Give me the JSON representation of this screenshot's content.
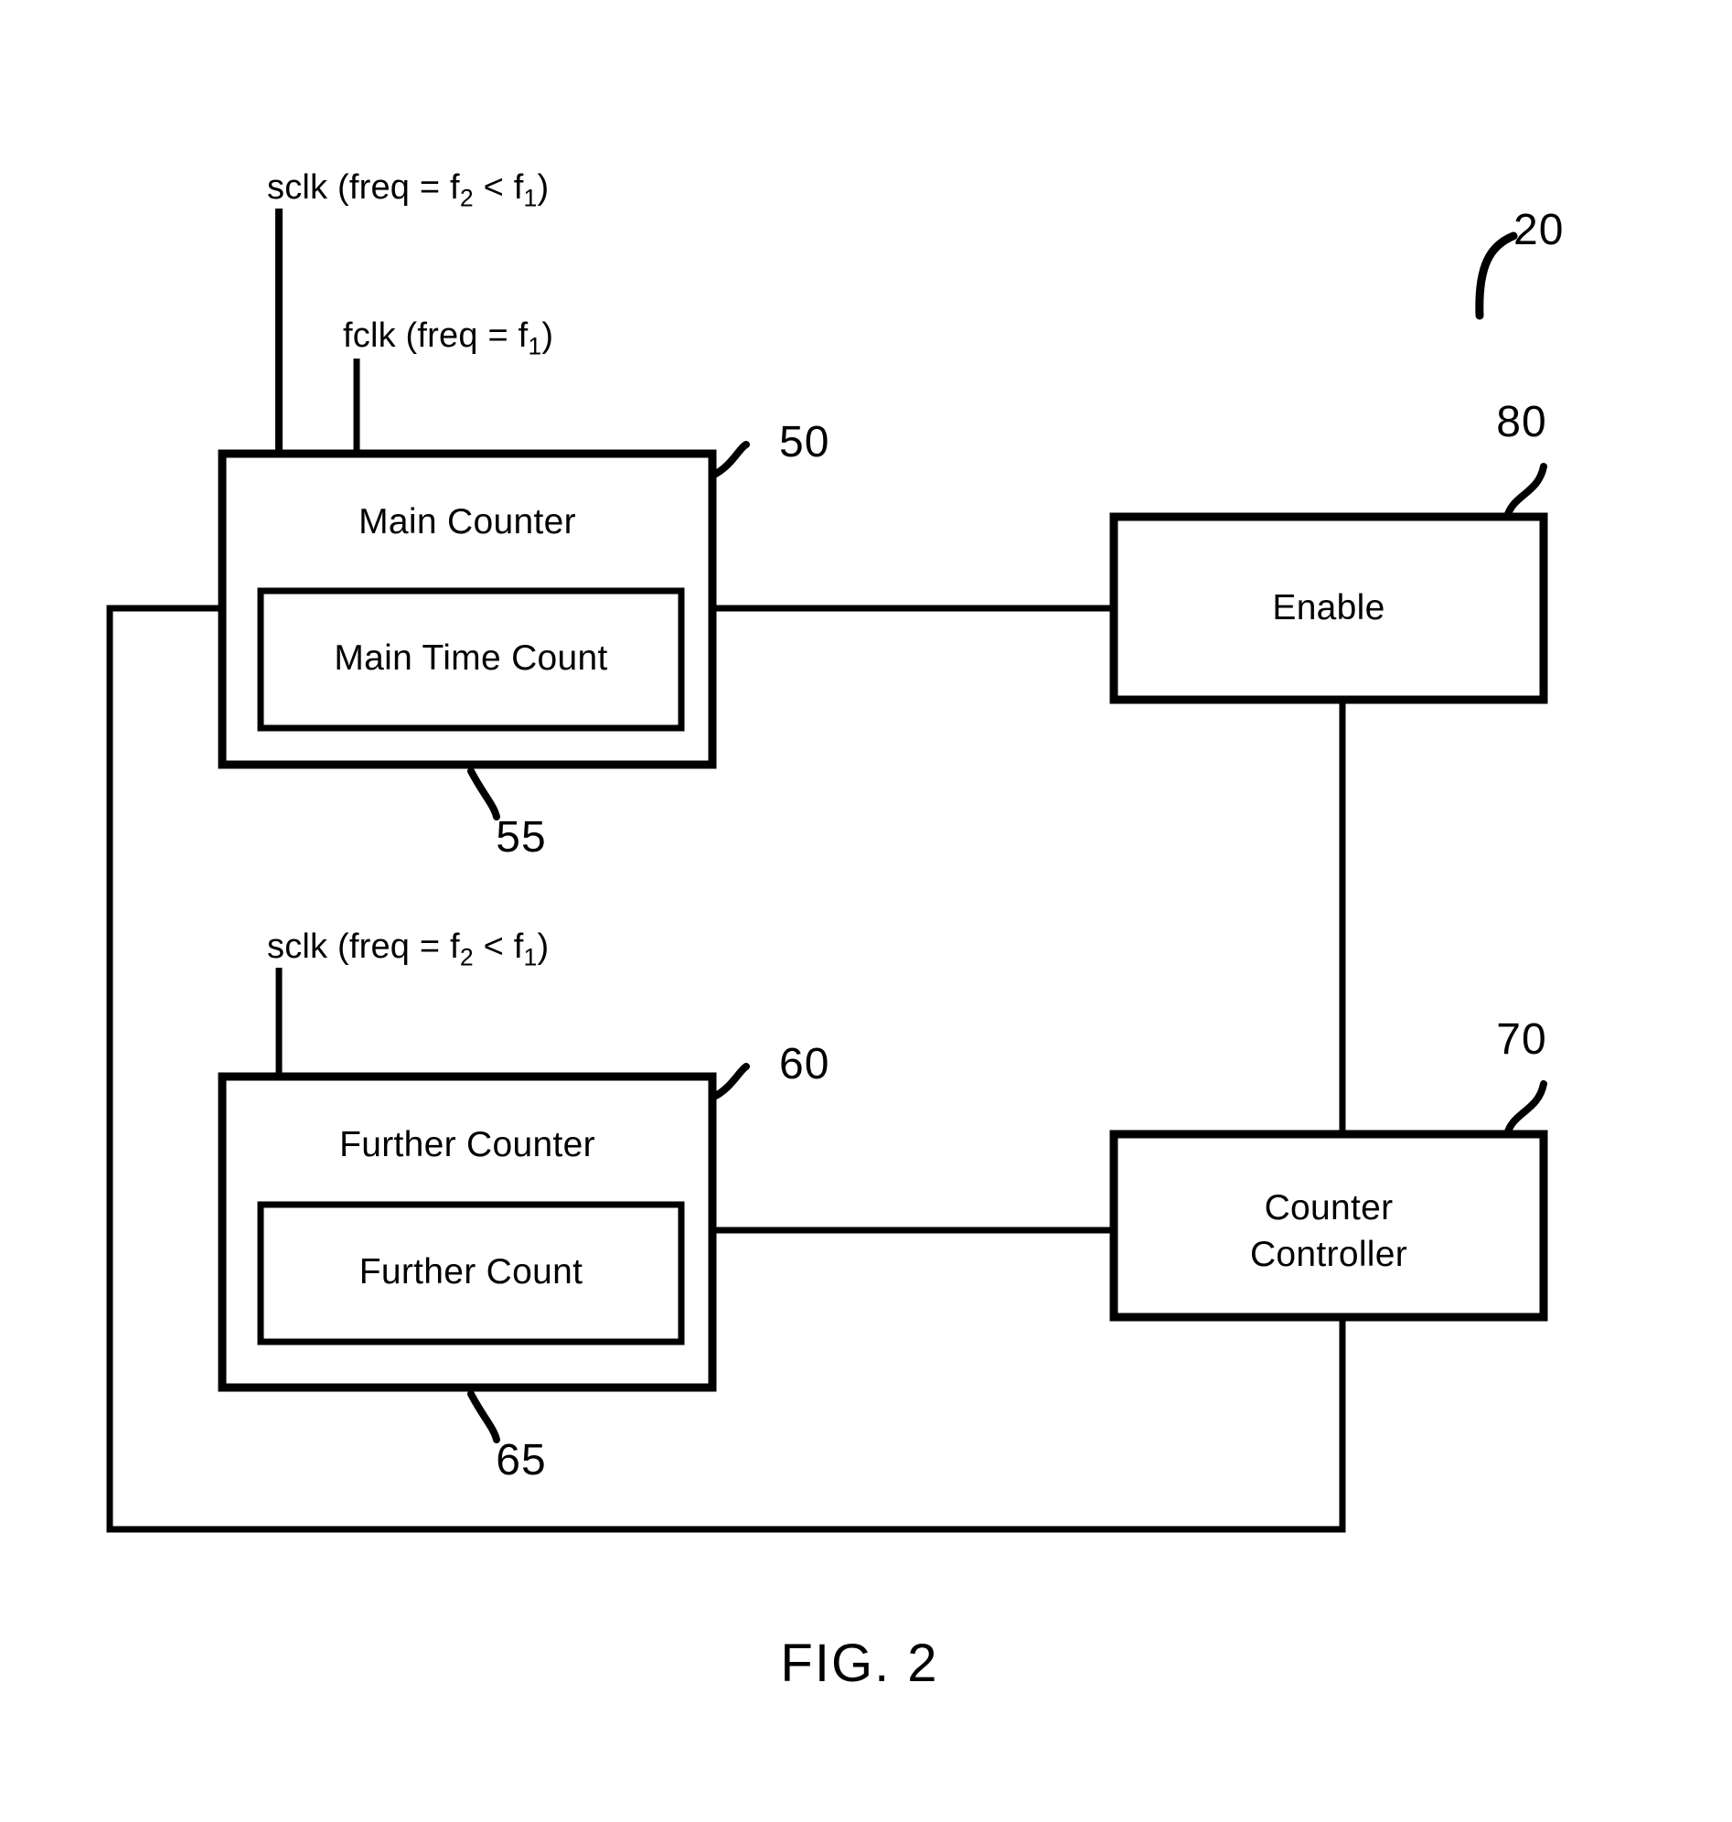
{
  "figure": {
    "caption": "FIG. 2",
    "system_ref": "20"
  },
  "clock_labels": {
    "main_sclk": {
      "prefix": "sclk (freq = f",
      "sub1": "2",
      "mid": " < f",
      "sub2": "1",
      "suffix": ")"
    },
    "main_fclk": {
      "prefix": "fclk (freq = f",
      "sub1": "1",
      "suffix": ")"
    },
    "further_sclk": {
      "prefix": "sclk (freq = f",
      "sub1": "2",
      "mid": " < f",
      "sub2": "1",
      "suffix": ")"
    }
  },
  "blocks": {
    "main_counter": {
      "title": "Main Counter",
      "ref": "50",
      "inner": {
        "title": "Main Time Count",
        "ref": "55"
      }
    },
    "further_counter": {
      "title": "Further Counter",
      "ref": "60",
      "inner": {
        "title": "Further Count",
        "ref": "65"
      }
    },
    "enable": {
      "title": "Enable",
      "ref": "80"
    },
    "counter_controller": {
      "title_line1": "Counter",
      "title_line2": "Controller",
      "ref": "70"
    }
  },
  "style": {
    "ink": "#000000",
    "paper": "#ffffff"
  }
}
